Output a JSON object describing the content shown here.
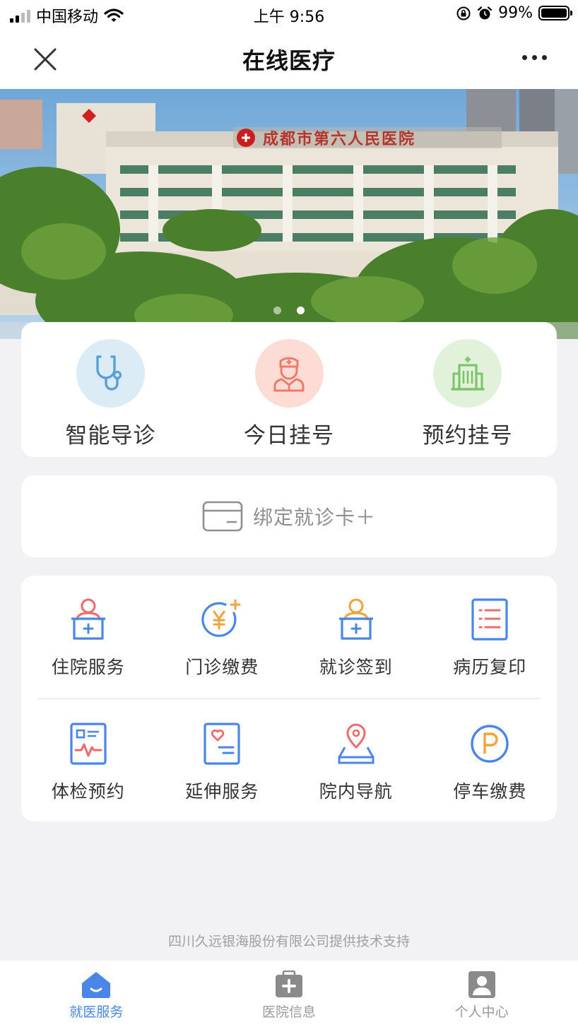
{
  "status_bar": {
    "carrier": "中国移动",
    "time": "上午 9:56",
    "battery": "99%"
  },
  "nav": {
    "title": "在线医疗"
  },
  "banner": {
    "sign_text": "成都市第六人民医院",
    "page_count": 2,
    "active_page": 2
  },
  "quick_actions": [
    {
      "label": "智能导诊",
      "icon": "stethoscope-icon",
      "color": "#5aa0d8",
      "bg": "#dcecf6"
    },
    {
      "label": "今日挂号",
      "icon": "doctor-icon",
      "color": "#f07a6a",
      "bg": "#fcdcd4"
    },
    {
      "label": "预约挂号",
      "icon": "hospital-building-icon",
      "color": "#7cc46a",
      "bg": "#e2f2da"
    }
  ],
  "bind_card": {
    "label": "绑定就诊卡＋"
  },
  "services": [
    {
      "label": "住院服务",
      "icon": "inpatient-icon"
    },
    {
      "label": "门诊缴费",
      "icon": "outpatient-payment-icon"
    },
    {
      "label": "就诊签到",
      "icon": "check-in-icon"
    },
    {
      "label": "病历复印",
      "icon": "medical-record-icon"
    },
    {
      "label": "体检预约",
      "icon": "checkup-icon"
    },
    {
      "label": "延伸服务",
      "icon": "extended-service-icon"
    },
    {
      "label": "院内导航",
      "icon": "navigation-icon"
    },
    {
      "label": "停车缴费",
      "icon": "parking-icon"
    }
  ],
  "footer_note": "四川久远银海股份有限公司提供技术支持",
  "tabs": [
    {
      "label": "就医服务",
      "active": true
    },
    {
      "label": "医院信息",
      "active": false
    },
    {
      "label": "个人中心",
      "active": false
    }
  ],
  "colors": {
    "primary": "#4a86e8",
    "accent_orange": "#f2a33a",
    "accent_red": "#ee6b6b"
  }
}
